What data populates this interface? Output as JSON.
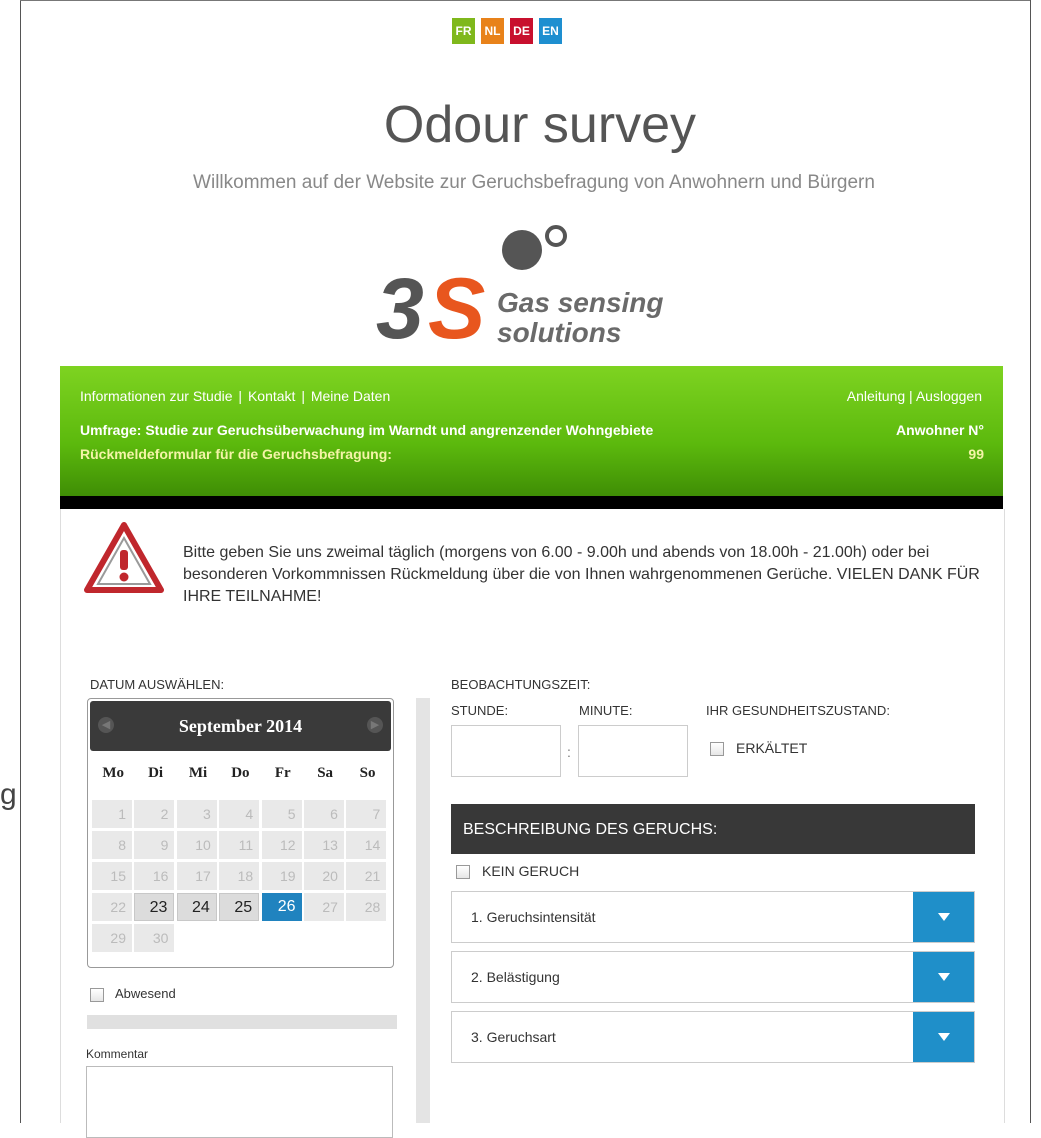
{
  "languages": [
    {
      "code": "FR",
      "color": "#7fb81c"
    },
    {
      "code": "NL",
      "color": "#e8821a"
    },
    {
      "code": "DE",
      "color": "#c8102e"
    },
    {
      "code": "EN",
      "color": "#1e8fd0"
    }
  ],
  "header": {
    "title": "Odour survey",
    "subtitle": "Willkommen auf der Website zur Geruchsbefragung von Anwohnern und Bürgern"
  },
  "logo": {
    "mark": "3S",
    "line1": "Gas sensing",
    "line2": "solutions"
  },
  "nav": {
    "left": [
      "Informationen zur Studie",
      "Kontakt",
      "Meine Daten"
    ],
    "right": [
      "Anleitung",
      "Ausloggen"
    ],
    "separator": " | "
  },
  "survey": {
    "title": "Umfrage: Studie zur Geruchsüberwachung im Warndt und angrenzender Wohngebiete",
    "form_title": "Rückmeldeformular für die Geruchsbefragung:",
    "resident_label": "Anwohner N°",
    "resident_number": "99"
  },
  "notice": "Bitte geben Sie uns zweimal täglich (morgens von 6.00 - 9.00h und abends von 18.00h - 21.00h) oder bei besonderen Vorkommnissen Rückmeldung über die von Ihnen wahrgenommenen Gerüche. VIELEN DANK FÜR IHRE TEILNAHME!",
  "date_section": {
    "label": "DATUM AUSWÄHLEN:",
    "month": "September 2014",
    "weekdays": [
      "Mo",
      "Di",
      "Mi",
      "Do",
      "Fr",
      "Sa",
      "So"
    ],
    "weeks": [
      [
        "1",
        "2",
        "3",
        "4",
        "5",
        "6",
        "7"
      ],
      [
        "8",
        "9",
        "10",
        "11",
        "12",
        "13",
        "14"
      ],
      [
        "15",
        "16",
        "17",
        "18",
        "19",
        "20",
        "21"
      ],
      [
        "22",
        "23",
        "24",
        "25",
        "26",
        "27",
        "28"
      ],
      [
        "29",
        "30"
      ]
    ],
    "active_days": [
      "23",
      "24",
      "25"
    ],
    "selected_day": "26",
    "absent_label": "Abwesend",
    "comment_label": "Kommentar"
  },
  "observation": {
    "label": "BEOBACHTUNGSZEIT:",
    "hour_label": "STUNDE:",
    "minute_label": "MINUTE:",
    "hour_value": "",
    "minute_value": "",
    "separator": ":",
    "health_label": "IHR GESUNDHEITSZUSTAND:",
    "cold_label": "ERKÄLTET"
  },
  "odour": {
    "header": "BESCHREIBUNG DES GERUCHS:",
    "none_label": "KEIN GERUCH",
    "dropdowns": [
      "1. Geruchsintensität",
      "2. Belästigung",
      "3. Geruchsart"
    ]
  },
  "colors": {
    "green_bar": "#6cc414",
    "accent_blue": "#1f8fc9",
    "dark_header": "#383838"
  }
}
